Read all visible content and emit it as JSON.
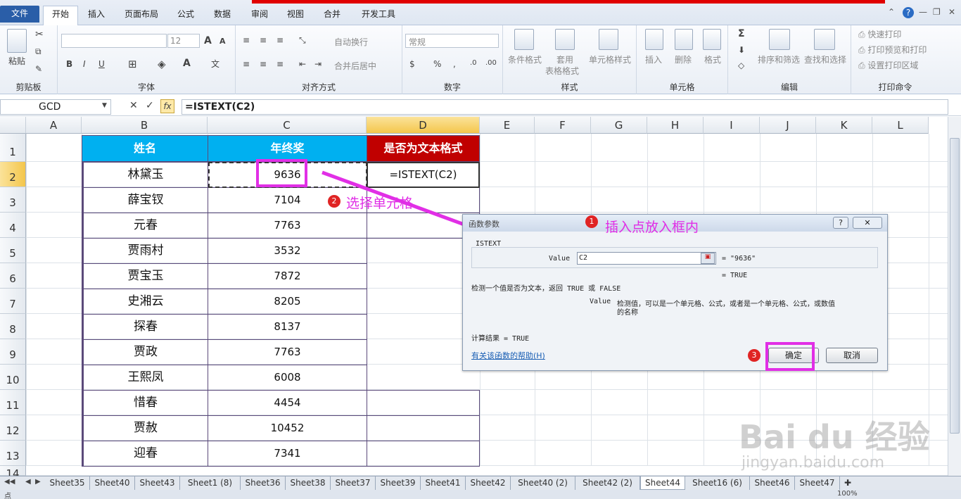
{
  "menu": {
    "tabs": [
      "文件",
      "开始",
      "插入",
      "页面布局",
      "公式",
      "数据",
      "审阅",
      "视图",
      "合并",
      "开发工具"
    ],
    "active": "开始"
  },
  "ribbon": {
    "clipboard": {
      "paste": "粘贴",
      "label": "剪贴板"
    },
    "font": {
      "size": "12",
      "label": "字体",
      "bold": "B",
      "italic": "I",
      "underline": "U",
      "grow": "A",
      "shrink": "A",
      "fontcolor": "A"
    },
    "align": {
      "wrap": "自动换行",
      "merge": "合并后居中",
      "label": "对齐方式"
    },
    "number": {
      "format": "常规",
      "percent": "%",
      "comma": ",",
      "label": "数字"
    },
    "styles": {
      "cond": "条件格式",
      "table1": "套用",
      "table2": "表格格式",
      "cellstyle": "单元格样式",
      "label": "样式"
    },
    "cells": {
      "insert": "插入",
      "delete": "删除",
      "format": "格式",
      "label": "单元格"
    },
    "edit": {
      "sort": "排序和筛选",
      "find": "查找和选择",
      "sigma": "Σ",
      "label": "编辑"
    },
    "print": {
      "quick": "快速打印",
      "preview": "打印预览和打印",
      "area": "设置打印区域",
      "label": "打印命令"
    }
  },
  "formulabar": {
    "namebox": "GCD",
    "fx": "fx",
    "formula": "=ISTEXT(C2)"
  },
  "columns": [
    "A",
    "B",
    "C",
    "D",
    "E",
    "F",
    "G",
    "H",
    "I",
    "J",
    "K",
    "L"
  ],
  "rows": [
    "1",
    "2",
    "3",
    "4",
    "5",
    "6",
    "7",
    "8",
    "9",
    "10",
    "11",
    "12",
    "13",
    "14"
  ],
  "table": {
    "headers": [
      "姓名",
      "年终奖",
      "是否为文本格式"
    ],
    "names": [
      "林黛玉",
      "薛宝钗",
      "元春",
      "贾雨村",
      "贾宝玉",
      "史湘云",
      "探春",
      "贾政",
      "王熙凤",
      "惜春",
      "贾赦",
      "迎春"
    ],
    "bonus": [
      "9636",
      "7104",
      "7763",
      "3532",
      "7872",
      "8205",
      "8137",
      "7763",
      "6008",
      "4454",
      "10452",
      "7341"
    ],
    "d2": "=ISTEXT(C2)",
    "header_colors": {
      "blue": "#00b0f0",
      "red": "#c00000"
    }
  },
  "annotations": {
    "a1": {
      "num": "1",
      "text": "插入点放入框内"
    },
    "a2": {
      "num": "2",
      "text": "选择单元格"
    },
    "a3": {
      "num": "3"
    },
    "color": "#e12fe6"
  },
  "dialog": {
    "title": "函数参数",
    "help_icon": "?",
    "close_icon": "✕",
    "fn": "ISTEXT",
    "arg_label": "Value",
    "arg_value": "C2",
    "arg_result": "= \"9636\"",
    "result_eq": "= TRUE",
    "desc": "检测一个值是否为文本，返回 TRUE 或 FALSE",
    "arg_desc_name": "Value",
    "arg_desc_l1": "检测值，可以是一个单元格、公式，或者是一个单元格、公式，或数值",
    "arg_desc_l2": "的名称",
    "calc": "计算结果 =  TRUE",
    "help_link": "有关该函数的帮助(H)",
    "ok": "确定",
    "cancel": "取消"
  },
  "sheets": [
    "Sheet35",
    "Sheet40",
    "Sheet43",
    "Sheet1 (8)",
    "Sheet36",
    "Sheet38",
    "Sheet37",
    "Sheet39",
    "Sheet41",
    "Sheet42",
    "Sheet40 (2)",
    "Sheet42 (2)",
    "Sheet44",
    "Sheet16 (6)",
    "Sheet46",
    "Sheet47"
  ],
  "active_sheet": "Sheet44",
  "status": {
    "zoom": "100%",
    "ready": "点"
  },
  "watermark": {
    "brand": "Bai du 经验",
    "url": "jingyan.baidu.com"
  }
}
